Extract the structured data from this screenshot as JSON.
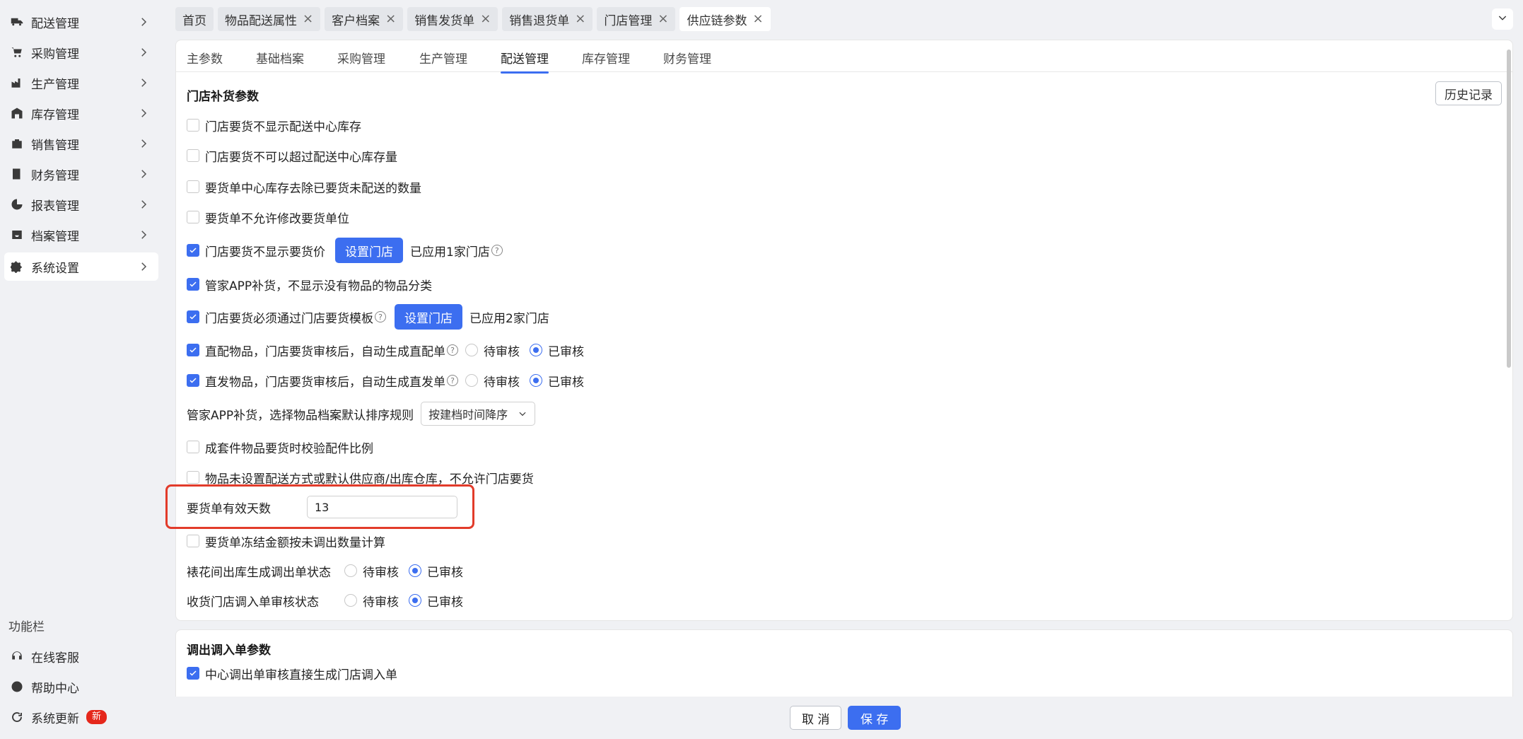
{
  "sidebar": {
    "items": [
      {
        "label": "配送管理",
        "icon": "truck-icon"
      },
      {
        "label": "采购管理",
        "icon": "cart-icon"
      },
      {
        "label": "生产管理",
        "icon": "factory-icon"
      },
      {
        "label": "库存管理",
        "icon": "warehouse-icon"
      },
      {
        "label": "销售管理",
        "icon": "bag-icon"
      },
      {
        "label": "财务管理",
        "icon": "ledger-icon"
      },
      {
        "label": "报表管理",
        "icon": "chart-pie-icon"
      },
      {
        "label": "档案管理",
        "icon": "archive-icon"
      },
      {
        "label": "系统设置",
        "icon": "gear-icon",
        "active": true
      }
    ],
    "function_bar_title": "功能栏",
    "function_items": [
      {
        "label": "在线客服",
        "icon": "headset-icon"
      },
      {
        "label": "帮助中心",
        "icon": "help-icon"
      },
      {
        "label": "系统更新",
        "icon": "refresh-icon",
        "badge": "新"
      }
    ]
  },
  "top_tabs": [
    {
      "label": "首页",
      "closable": false
    },
    {
      "label": "物品配送属性",
      "closable": true
    },
    {
      "label": "客户档案",
      "closable": true
    },
    {
      "label": "销售发货单",
      "closable": true
    },
    {
      "label": "销售退货单",
      "closable": true
    },
    {
      "label": "门店管理",
      "closable": true
    },
    {
      "label": "供应链参数",
      "closable": true,
      "active": true
    }
  ],
  "sub_tabs": [
    "主参数",
    "基础档案",
    "采购管理",
    "生产管理",
    "配送管理",
    "库存管理",
    "财务管理"
  ],
  "active_sub_tab": "配送管理",
  "section1": {
    "title": "门店补货参数",
    "history_button": "历史记录",
    "opt_no_show_center_stock": "门店要货不显示配送中心库存",
    "opt_no_exceed_center_stock": "门店要货不可以超过配送中心库存量",
    "opt_exclude_undelivered": "要货单中心库存去除已要货未配送的数量",
    "opt_no_modify_unit": "要货单不允许修改要货单位",
    "opt_no_show_price": "门店要货不显示要货价",
    "set_store_button": "设置门店",
    "applied_1": "已应用1家门店",
    "opt_app_hide_empty_category": "管家APP补货，不显示没有物品的物品分类",
    "opt_must_use_template": "门店要货必须通过门店要货模板",
    "applied_2": "已应用2家门店",
    "opt_direct_delivery": "直配物品，门店要货审核后，自动生成直配单",
    "opt_direct_ship": "直发物品，门店要货审核后，自动生成直发单",
    "radio_pending": "待审核",
    "radio_approved": "已审核",
    "sort_rule_label": "管家APP补货，选择物品档案默认排序规则",
    "sort_rule_value": "按建档时间降序",
    "opt_kit_ratio_check": "成套件物品要货时校验配件比例",
    "opt_no_delivery_method": "物品未设置配送方式或默认供应商/出库仓库，不允许门店要货",
    "valid_days_label": "要货单有效天数",
    "valid_days_value": "13",
    "opt_freeze_amount": "要货单冻结金额按未调出数量计算",
    "workshop_label": "裱花间出库生成调出单状态",
    "receiving_label": "收货门店调入单审核状态"
  },
  "section2": {
    "title": "调出调入单参数",
    "opt_auto_transfer_in": "中心调出单审核直接生成门店调入单"
  },
  "footer": {
    "cancel": "取 消",
    "save": "保 存"
  },
  "colors": {
    "primary": "#3c6ef0",
    "highlight": "#e23b2a",
    "badge": "#e5271b"
  }
}
